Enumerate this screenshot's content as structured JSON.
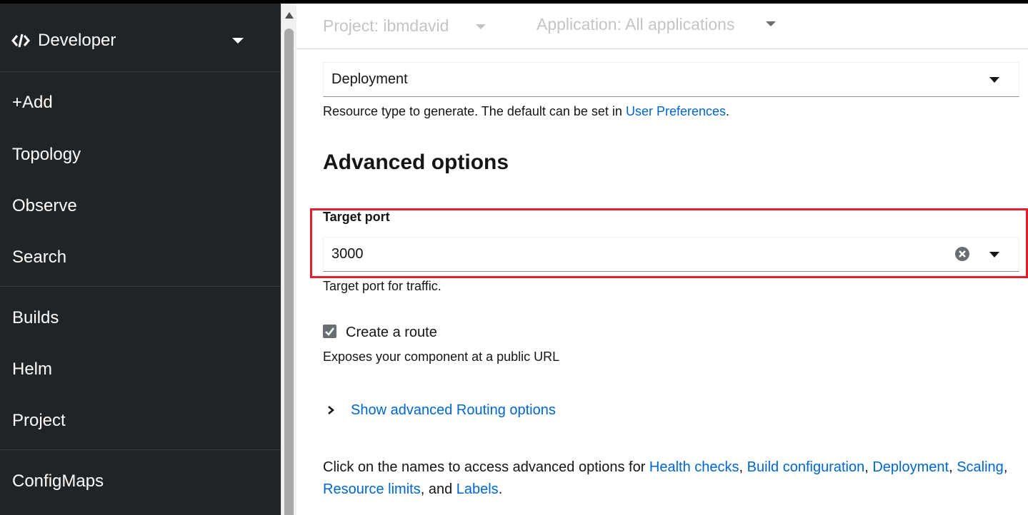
{
  "perspective": {
    "label": "Developer",
    "icon": "code-icon"
  },
  "nav": {
    "items": [
      {
        "label": "+Add"
      },
      {
        "label": "Topology"
      },
      {
        "label": "Observe"
      },
      {
        "label": "Search"
      },
      {
        "label": "Builds"
      },
      {
        "label": "Helm"
      },
      {
        "label": "Project"
      },
      {
        "label": "ConfigMaps"
      }
    ]
  },
  "context": {
    "project": "Project: ibmdavid",
    "application": "Application: All applications"
  },
  "resource_type": {
    "value": "Deployment",
    "helper_prefix": "Resource type to generate. The default can be set in ",
    "helper_link": "User Preferences",
    "helper_suffix": "."
  },
  "advanced": {
    "title": "Advanced options",
    "target_port": {
      "label": "Target port",
      "value": "3000",
      "helper": "Target port for traffic."
    },
    "route": {
      "checked": true,
      "label": "Create a route",
      "helper": "Exposes your component at a public URL"
    },
    "routing_toggle": "Show advanced Routing options",
    "footer": {
      "prefix": "Click on the names to access advanced options for ",
      "links": [
        "Health checks",
        "Build configuration",
        "Deployment",
        "Scaling",
        "Resource limits",
        "Labels"
      ],
      "sep": ", ",
      "and": ", and ",
      "end": "."
    }
  },
  "colors": {
    "sidebar_bg": "#212427",
    "link": "#0066cc",
    "highlight": "#e0202e"
  }
}
